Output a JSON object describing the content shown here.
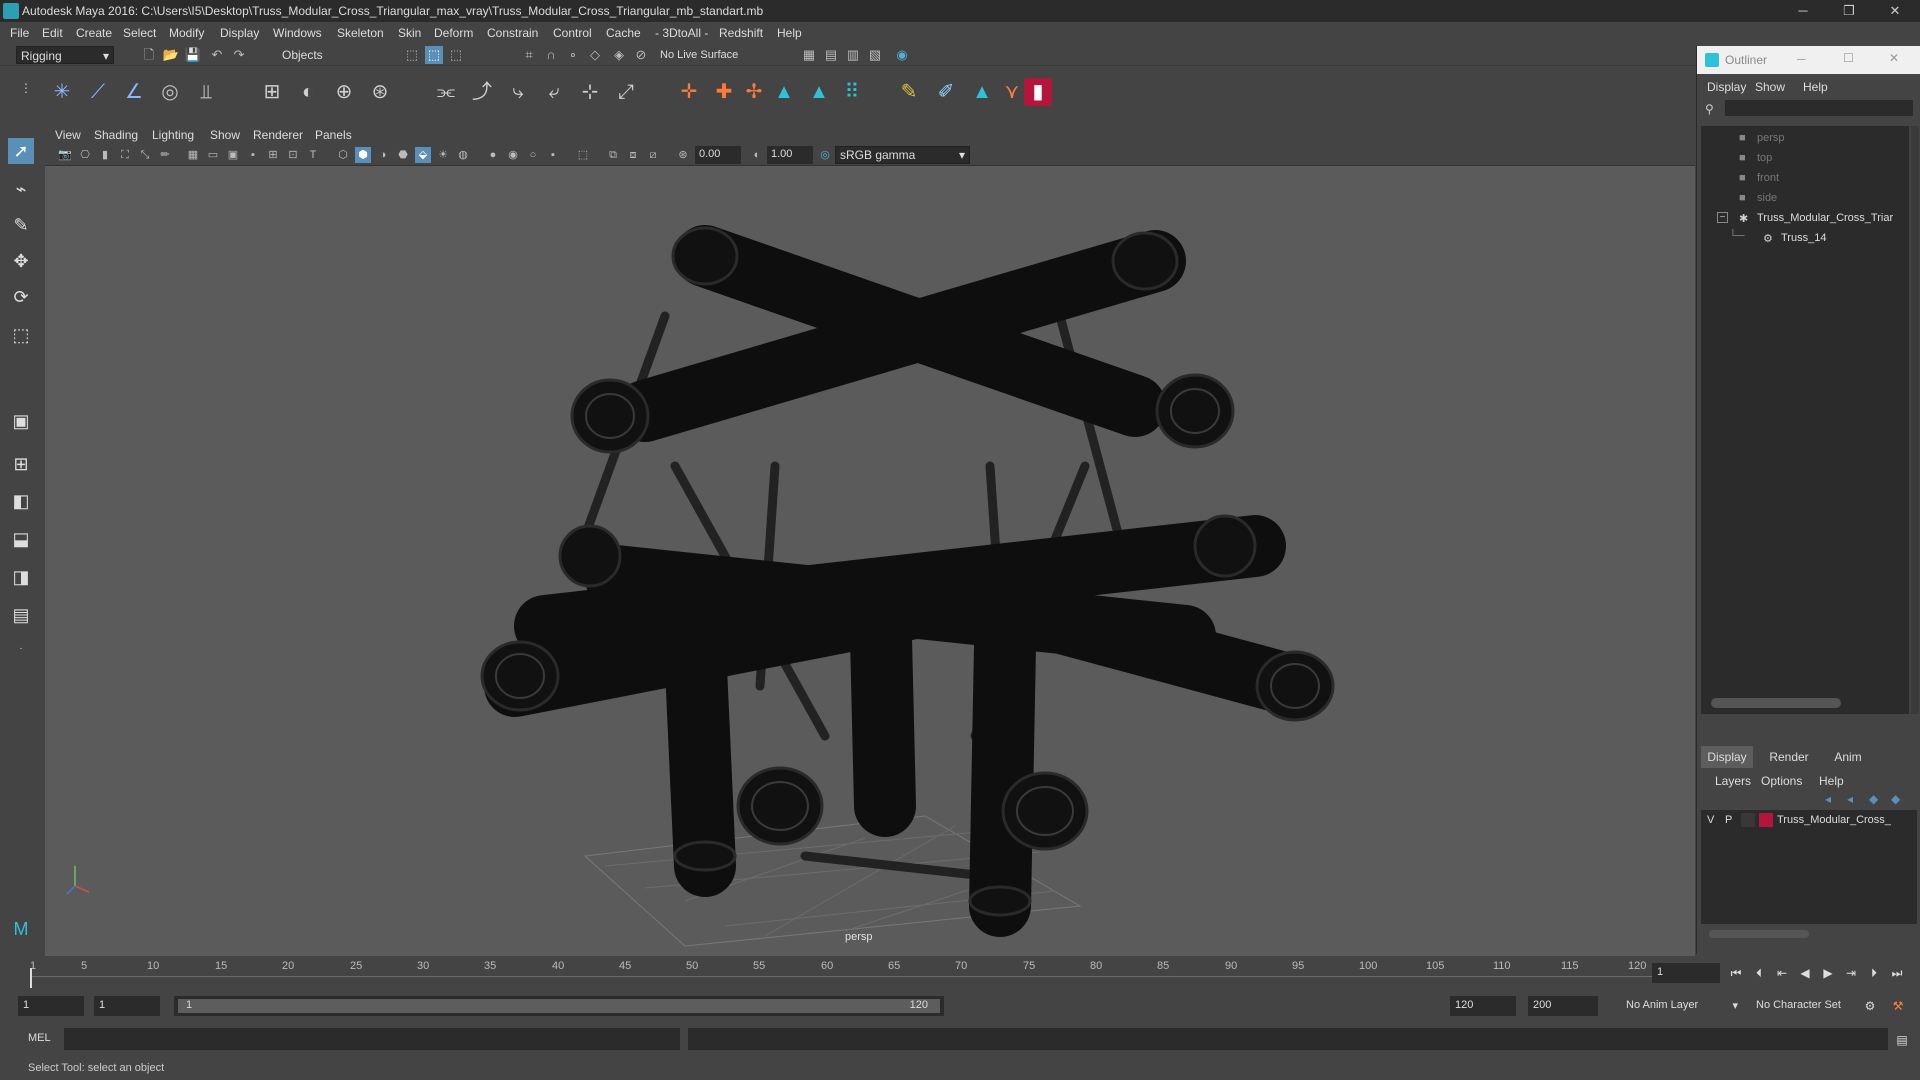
{
  "window": {
    "title": "Autodesk Maya 2016: C:\\Users\\I5\\Desktop\\Truss_Modular_Cross_Triangular_max_vray\\Truss_Modular_Cross_Triangular_mb_standart.mb",
    "minimize": "─",
    "maximize": "❐",
    "close": "✕"
  },
  "menubar": [
    "File",
    "Edit",
    "Create",
    "Select",
    "Modify",
    "Display",
    "Windows",
    "Skeleton",
    "Skin",
    "Deform",
    "Constrain",
    "Control",
    "Cache",
    "- 3DtoAll -",
    "Redshift",
    "Help"
  ],
  "statusline": {
    "menu_set": "Rigging",
    "selection_mode": "Objects",
    "live_surface": "No Live Surface"
  },
  "viewport": {
    "menu": [
      "View",
      "Shading",
      "Lighting",
      "Show",
      "Renderer",
      "Panels"
    ],
    "exposure": "0.00",
    "gamma": "1.00",
    "color_space": "sRGB gamma",
    "camera_label": "persp"
  },
  "outliner": {
    "title": "Outliner",
    "menu": [
      "Display",
      "Show",
      "Help"
    ],
    "items": [
      {
        "label": "persp"
      },
      {
        "label": "top"
      },
      {
        "label": "front"
      },
      {
        "label": "side"
      },
      {
        "label": "Truss_Modular_Cross_Triar"
      },
      {
        "label": "Truss_14"
      }
    ]
  },
  "layers": {
    "tabs": [
      "Display",
      "Render",
      "Anim"
    ],
    "menu": [
      "Layers",
      "Options",
      "Help"
    ],
    "row": {
      "v": "V",
      "p": "P",
      "name": "Truss_Modular_Cross_",
      "color": "#b3163a"
    }
  },
  "timeline": {
    "ticks": [
      "5",
      "10",
      "15",
      "20",
      "25",
      "30",
      "35",
      "40",
      "45",
      "50",
      "55",
      "60",
      "65",
      "70",
      "75",
      "80",
      "85",
      "90",
      "95",
      "100",
      "105",
      "110",
      "115",
      "120"
    ],
    "start_tick": "1",
    "current_frame": "1"
  },
  "range": {
    "start": "1",
    "current": "1",
    "slider_start": "1",
    "slider_end": "120",
    "end": "120",
    "max": "200",
    "anim_layer": "No Anim Layer",
    "character_set": "No Character Set"
  },
  "cmdline": {
    "label": "MEL"
  },
  "helpline": {
    "text": "Select Tool: select an object"
  },
  "colors": {
    "layer_color": "#b3163a",
    "accent": "#5a8fb8"
  }
}
